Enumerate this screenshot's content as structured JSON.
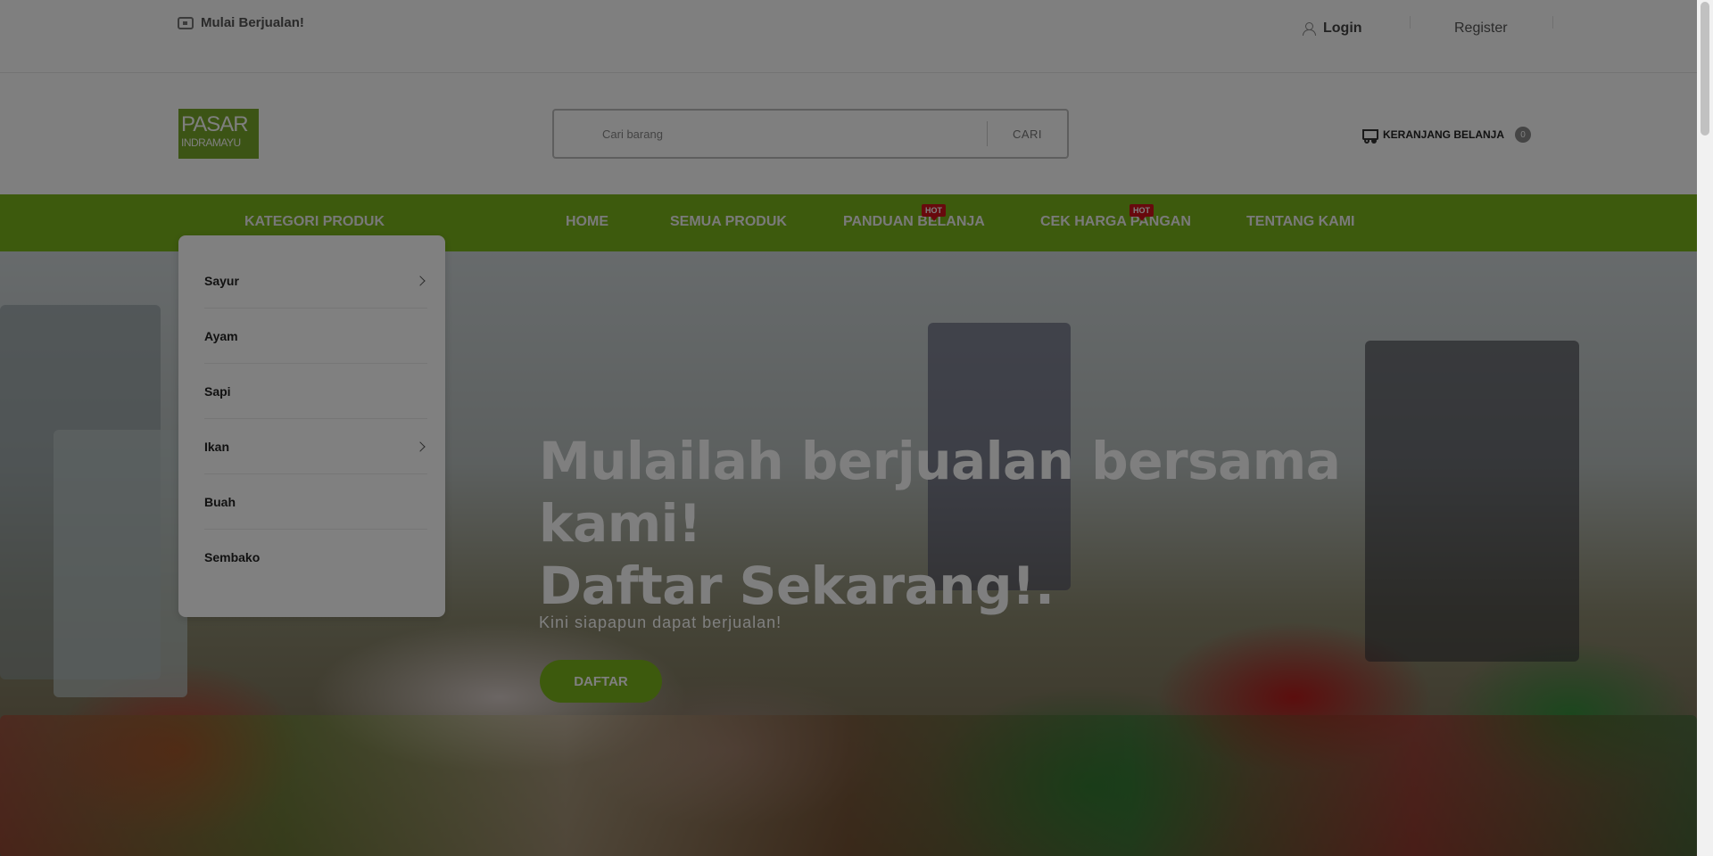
{
  "topbar": {
    "sell_label": "Mulai Berjualan!",
    "login_label": "Login",
    "register_label": "Register"
  },
  "header": {
    "logo_line1": "PASAR",
    "logo_line2": "INDRAMAYU",
    "search_placeholder": "Cari barang",
    "search_button": "CARI",
    "cart_label": "KERANJANG BELANJA",
    "cart_count": "0"
  },
  "nav": {
    "category_label": "KATEGORI PRODUK",
    "items": [
      {
        "label": "HOME"
      },
      {
        "label": "SEMUA PRODUK"
      },
      {
        "label": "PANDUAN BELANJA",
        "badge": "HOT"
      },
      {
        "label": "CEK HARGA PANGAN",
        "badge": "HOT"
      },
      {
        "label": "TENTANG KAMI"
      }
    ]
  },
  "categories": [
    {
      "label": "Sayur",
      "has_sub": true
    },
    {
      "label": "Ayam",
      "has_sub": false
    },
    {
      "label": "Sapi",
      "has_sub": false
    },
    {
      "label": "Ikan",
      "has_sub": true
    },
    {
      "label": "Buah",
      "has_sub": false
    },
    {
      "label": "Sembako",
      "has_sub": false
    }
  ],
  "hero": {
    "title_line1": "Mulailah berjualan bersama",
    "title_line2": "kami!",
    "title_line3": "Daftar Sekarang!.",
    "subtitle": "Kini siapapun dapat berjualan!",
    "button": "DAFTAR"
  },
  "colors": {
    "brand_green": "#7bb51b",
    "hot_red": "#d0131b"
  }
}
